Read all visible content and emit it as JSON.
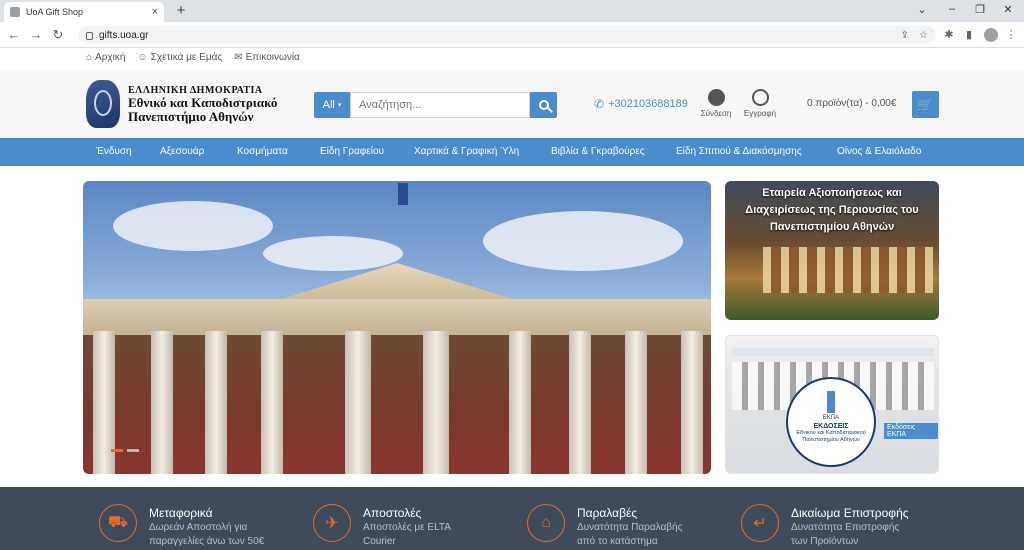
{
  "browser": {
    "tab_title": "UoA Gift Shop",
    "tab_close": "×",
    "new_tab": "+",
    "url": "gifts.uoa.gr"
  },
  "toplinks": [
    {
      "icon": "home-icon",
      "label": "Αρχική"
    },
    {
      "icon": "user-icon",
      "label": "Σχετικά με Εμάς"
    },
    {
      "icon": "mail-icon",
      "label": "Επικοινωνία"
    }
  ],
  "logo": {
    "line1": "ΕΛΛΗΝΙΚΗ ΔΗΜΟΚΡΑΤΙΑ",
    "line2": "Εθνικό και Καποδιστριακό",
    "line3": "Πανεπιστήμιο Αθηνών"
  },
  "search": {
    "category": "All",
    "placeholder": "Αναζήτηση..."
  },
  "header": {
    "phone": "+302103688189",
    "login_label": "Σύνδεση",
    "register_label": "Εγγραφή",
    "cart_text": "0 προϊόν(τα) - 0,00€"
  },
  "nav": [
    "Ένδυση",
    "Αξεσουάρ",
    "Κοσμήματα",
    "Είδη Γραφείου",
    "Χαρτικά & Γραφική Ύλη",
    "Βιβλία & Γκραβούρες",
    "Είδη Σπιτιού & Διακόσμησης",
    "Οίνος & Ελαιόλαδο"
  ],
  "side_banner_1": {
    "text": "Εταιρεία Αξιοποιήσεως και Διαχειρίσεως της Περιουσίας του Πανεπιστημίου Αθηνών"
  },
  "side_banner_2": {
    "badge": "Εκδόσεις ΕΚΠΑ",
    "emblem_top": "ΕΚΠΑ",
    "emblem_title": "ΕΚΔΟΣΕΙΣ",
    "emblem_sub": "Εθνικού και Καποδιστριακού Πανεπιστημίου Αθηνών"
  },
  "features": [
    {
      "icon": "truck-icon",
      "title": "Μεταφορικά",
      "line1": "Δωρεάν Αποστολή για",
      "line2": "παραγγελίες άνω των 50€"
    },
    {
      "icon": "plane-icon",
      "title": "Αποστολές",
      "line1": "Αποστολές με ELTA",
      "line2": "Courier"
    },
    {
      "icon": "store-icon",
      "title": "Παραλαβές",
      "line1": "Δυνατότητα Παραλαβής",
      "line2": "από το κατάστημα"
    },
    {
      "icon": "return-icon",
      "title": "Δικαίωμα Επιστροφής",
      "line1": "Δυνατότητα Επιστροφής",
      "line2": "των Προϊόντων"
    }
  ],
  "colors": {
    "accent": "#4a8ccc",
    "orange": "#e86a2b",
    "footer_bg": "#3f4a5a"
  }
}
